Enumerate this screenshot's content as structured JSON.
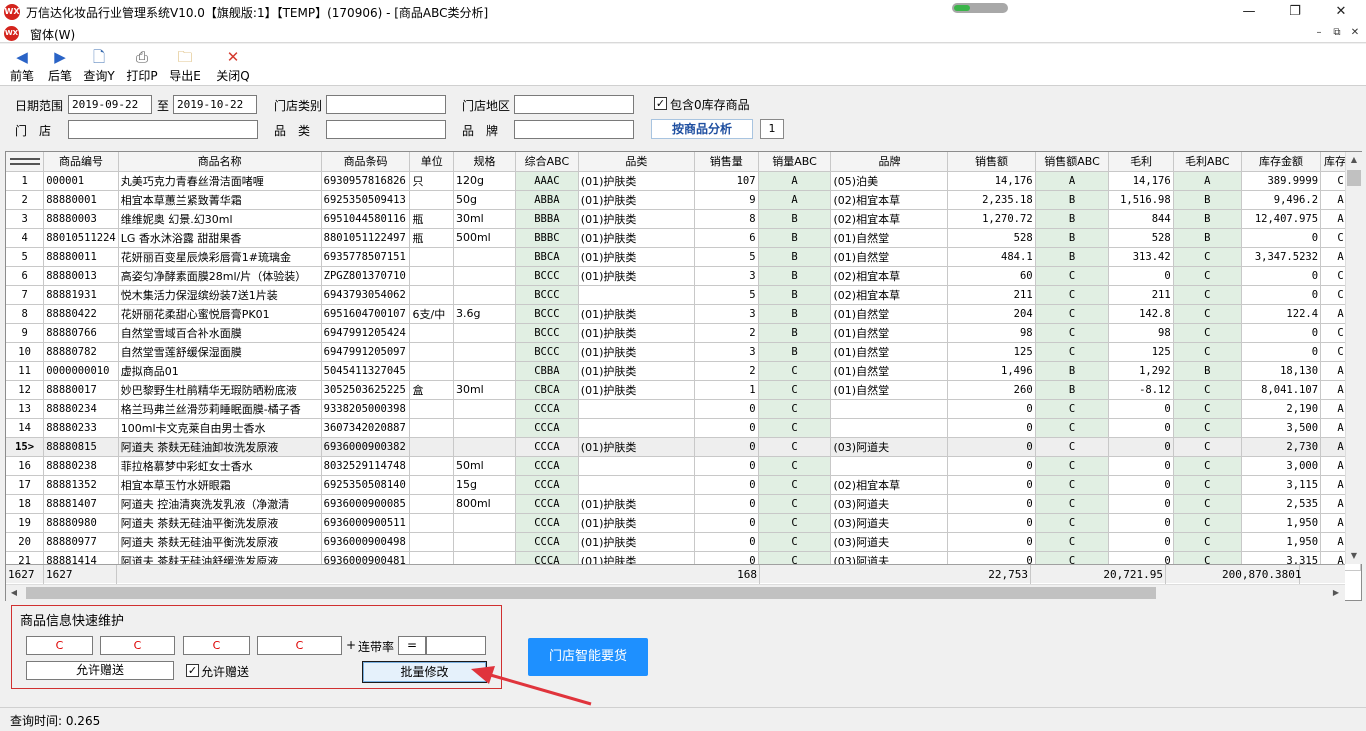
{
  "window": {
    "title": "万信达化妆品行业管理系统V10.0【旗舰版:1】【TEMP】(170906) - [商品ABC类分析]",
    "minimize_icon": "minimize-icon",
    "maximize_icon": "restore-icon",
    "close_icon": "close-icon"
  },
  "menu": {
    "window_label": "窗体(W)"
  },
  "toolbar": {
    "prev": "前笔",
    "next": "后笔",
    "query": "查询Y",
    "print": "打印P",
    "export": "导出E",
    "close": "关闭Q"
  },
  "filter": {
    "date_label": "日期范围",
    "date_from": "2019-09-22",
    "date_to_label": "至",
    "date_to": "2019-10-22",
    "store_type_label": "门店类别",
    "store_type": "",
    "store_area_label": "门店地区",
    "store_area": "",
    "include_zero_label": "包含0库存商品",
    "include_zero_checked": "✓",
    "store_label": "门　店",
    "store": "",
    "category_label": "品　类",
    "category": "",
    "brand_label": "品　牌",
    "brand": "",
    "analysis_mode": "按商品分析",
    "analysis_num": "1"
  },
  "grid": {
    "columns": [
      "商品编号",
      "商品名称",
      "商品条码",
      "单位",
      "规格",
      "综合ABC",
      "品类",
      "销售量",
      "销量ABC",
      "品牌",
      "销售额",
      "销售额ABC",
      "毛利",
      "毛利ABC",
      "库存金额",
      "库存金"
    ],
    "rows": [
      {
        "no": "1",
        "code": "000001",
        "name": "丸美巧克力青春丝滑洁面啫喱",
        "barcode": "6930957816826",
        "unit": "只",
        "spec": "120g",
        "abc": "AAAC",
        "ptype": "(01)护肤类",
        "qty": "107",
        "qabc": "A",
        "brand": "(05)泊美",
        "amt": "14,176",
        "aabc": "A",
        "profit": "14,176",
        "pabc": "A",
        "stock": "389.9999",
        "sabc": "C"
      },
      {
        "no": "2",
        "code": "88880001",
        "name": "相宜本草蕙兰紧致菁华霜",
        "barcode": "6925350509413",
        "unit": "",
        "spec": "50g",
        "abc": "ABBA",
        "ptype": "(01)护肤类",
        "qty": "9",
        "qabc": "A",
        "brand": "(02)相宜本草",
        "amt": "2,235.18",
        "aabc": "B",
        "profit": "1,516.98",
        "pabc": "B",
        "stock": "9,496.2",
        "sabc": "A"
      },
      {
        "no": "3",
        "code": "88880003",
        "name": "维维妮奥 幻景.幻30ml",
        "barcode": "6951044580116",
        "unit": "瓶",
        "spec": "30ml",
        "abc": "BBBA",
        "ptype": "(01)护肤类",
        "qty": "8",
        "qabc": "B",
        "brand": "(02)相宜本草",
        "amt": "1,270.72",
        "aabc": "B",
        "profit": "844",
        "pabc": "B",
        "stock": "12,407.975",
        "sabc": "A"
      },
      {
        "no": "4",
        "code": "88010511224",
        "name": "LG 香水沐浴露 甜甜果香",
        "barcode": "8801051122497",
        "unit": "瓶",
        "spec": "500ml",
        "abc": "BBBC",
        "ptype": "(01)护肤类",
        "qty": "6",
        "qabc": "B",
        "brand": "(01)自然堂",
        "amt": "528",
        "aabc": "B",
        "profit": "528",
        "pabc": "B",
        "stock": "0",
        "sabc": "C"
      },
      {
        "no": "5",
        "code": "88880011",
        "name": "花妍丽百变星辰焕彩唇膏1#琉璃金",
        "barcode": "6935778507151",
        "unit": "",
        "spec": "",
        "abc": "BBCA",
        "ptype": "(01)护肤类",
        "qty": "5",
        "qabc": "B",
        "brand": "(01)自然堂",
        "amt": "484.1",
        "aabc": "B",
        "profit": "313.42",
        "pabc": "C",
        "stock": "3,347.5232",
        "sabc": "A"
      },
      {
        "no": "6",
        "code": "88880013",
        "name": "高姿匀净酵素面膜28ml/片（体验装）",
        "barcode": "ZPGZ801370710",
        "unit": "",
        "spec": "",
        "abc": "BCCC",
        "ptype": "(01)护肤类",
        "qty": "3",
        "qabc": "B",
        "brand": "(02)相宜本草",
        "amt": "60",
        "aabc": "C",
        "profit": "0",
        "pabc": "C",
        "stock": "0",
        "sabc": "C"
      },
      {
        "no": "7",
        "code": "88881931",
        "name": "悦木集活力保湿缤纷装7送1片装",
        "barcode": "6943793054062",
        "unit": "",
        "spec": "",
        "abc": "BCCC",
        "ptype": "",
        "qty": "5",
        "qabc": "B",
        "brand": "(02)相宜本草",
        "amt": "211",
        "aabc": "C",
        "profit": "211",
        "pabc": "C",
        "stock": "0",
        "sabc": "C"
      },
      {
        "no": "8",
        "code": "88880422",
        "name": "花妍丽花柔甜心蜜悦唇膏PK01",
        "barcode": "6951604700107",
        "unit": "6支/中",
        "spec": "3.6g",
        "abc": "BCCC",
        "ptype": "(01)护肤类",
        "qty": "3",
        "qabc": "B",
        "brand": "(01)自然堂",
        "amt": "204",
        "aabc": "C",
        "profit": "142.8",
        "pabc": "C",
        "stock": "122.4",
        "sabc": "A"
      },
      {
        "no": "9",
        "code": "88880766",
        "name": "自然堂雪域百合补水面膜",
        "barcode": "6947991205424",
        "unit": "",
        "spec": "",
        "abc": "BCCC",
        "ptype": "(01)护肤类",
        "qty": "2",
        "qabc": "B",
        "brand": "(01)自然堂",
        "amt": "98",
        "aabc": "C",
        "profit": "98",
        "pabc": "C",
        "stock": "0",
        "sabc": "C"
      },
      {
        "no": "10",
        "code": "88880782",
        "name": "自然堂雪莲舒缓保湿面膜",
        "barcode": "6947991205097",
        "unit": "",
        "spec": "",
        "abc": "BCCC",
        "ptype": "(01)护肤类",
        "qty": "3",
        "qabc": "B",
        "brand": "(01)自然堂",
        "amt": "125",
        "aabc": "C",
        "profit": "125",
        "pabc": "C",
        "stock": "0",
        "sabc": "C"
      },
      {
        "no": "11",
        "code": "0000000010",
        "name": "虚拟商品01",
        "barcode": "5045411327045",
        "unit": "",
        "spec": "",
        "abc": "CBBA",
        "ptype": "(01)护肤类",
        "qty": "2",
        "qabc": "C",
        "brand": "(01)自然堂",
        "amt": "1,496",
        "aabc": "B",
        "profit": "1,292",
        "pabc": "B",
        "stock": "18,130",
        "sabc": "A"
      },
      {
        "no": "12",
        "code": "88880017",
        "name": "妙巴黎野生杜鹃精华无瑕防晒粉底液",
        "barcode": "3052503625225",
        "unit": "盒",
        "spec": "30ml",
        "abc": "CBCA",
        "ptype": "(01)护肤类",
        "qty": "1",
        "qabc": "C",
        "brand": "(01)自然堂",
        "amt": "260",
        "aabc": "B",
        "profit": "-8.12",
        "pabc": "C",
        "stock": "8,041.107",
        "sabc": "A"
      },
      {
        "no": "13",
        "code": "88880234",
        "name": "格兰玛弗兰丝滑莎莉睡眠面膜-橘子香",
        "barcode": "9338205000398",
        "unit": "",
        "spec": "",
        "abc": "CCCA",
        "ptype": "",
        "qty": "0",
        "qabc": "C",
        "brand": "",
        "amt": "0",
        "aabc": "C",
        "profit": "0",
        "pabc": "C",
        "stock": "2,190",
        "sabc": "A"
      },
      {
        "no": "14",
        "code": "88880233",
        "name": "100ml卡文克莱自由男士香水",
        "barcode": "3607342020887",
        "unit": "",
        "spec": "",
        "abc": "CCCA",
        "ptype": "",
        "qty": "0",
        "qabc": "C",
        "brand": "",
        "amt": "0",
        "aabc": "C",
        "profit": "0",
        "pabc": "C",
        "stock": "3,500",
        "sabc": "A"
      },
      {
        "no": "15>",
        "code": "88880815",
        "name": "阿道夫 茶麸无硅油卸妆洗发原液",
        "barcode": "6936000900382",
        "unit": "",
        "spec": "",
        "abc": "CCCA",
        "ptype": "(01)护肤类",
        "qty": "0",
        "qabc": "C",
        "brand": "(03)阿道夫",
        "amt": "0",
        "aabc": "C",
        "profit": "0",
        "pabc": "C",
        "stock": "2,730",
        "sabc": "A",
        "sel": true
      },
      {
        "no": "16",
        "code": "88880238",
        "name": "菲拉格慕梦中彩虹女士香水",
        "barcode": "8032529114748",
        "unit": "",
        "spec": "50ml",
        "abc": "CCCA",
        "ptype": "",
        "qty": "0",
        "qabc": "C",
        "brand": "",
        "amt": "0",
        "aabc": "C",
        "profit": "0",
        "pabc": "C",
        "stock": "3,000",
        "sabc": "A"
      },
      {
        "no": "17",
        "code": "88881352",
        "name": "相宜本草玉竹水妍眼霜",
        "barcode": "6925350508140",
        "unit": "",
        "spec": "15g",
        "abc": "CCCA",
        "ptype": "",
        "qty": "0",
        "qabc": "C",
        "brand": "(02)相宜本草",
        "amt": "0",
        "aabc": "C",
        "profit": "0",
        "pabc": "C",
        "stock": "3,115",
        "sabc": "A"
      },
      {
        "no": "18",
        "code": "88881407",
        "name": "阿道夫 控油清爽洗发乳液（净澈清",
        "barcode": "6936000900085",
        "unit": "",
        "spec": "800ml",
        "abc": "CCCA",
        "ptype": "(01)护肤类",
        "qty": "0",
        "qabc": "C",
        "brand": "(03)阿道夫",
        "amt": "0",
        "aabc": "C",
        "profit": "0",
        "pabc": "C",
        "stock": "2,535",
        "sabc": "A"
      },
      {
        "no": "19",
        "code": "88880980",
        "name": "阿道夫 茶麸无硅油平衡洗发原液",
        "barcode": "6936000900511",
        "unit": "",
        "spec": "",
        "abc": "CCCA",
        "ptype": "(01)护肤类",
        "qty": "0",
        "qabc": "C",
        "brand": "(03)阿道夫",
        "amt": "0",
        "aabc": "C",
        "profit": "0",
        "pabc": "C",
        "stock": "1,950",
        "sabc": "A"
      },
      {
        "no": "20",
        "code": "88880977",
        "name": "阿道夫 茶麸无硅油平衡洗发原液",
        "barcode": "6936000900498",
        "unit": "",
        "spec": "",
        "abc": "CCCA",
        "ptype": "(01)护肤类",
        "qty": "0",
        "qabc": "C",
        "brand": "(03)阿道夫",
        "amt": "0",
        "aabc": "C",
        "profit": "0",
        "pabc": "C",
        "stock": "1,950",
        "sabc": "A"
      },
      {
        "no": "21",
        "code": "88881414",
        "name": "阿道夫 茶麸无硅油舒缓洗发原液",
        "barcode": "6936000900481",
        "unit": "",
        "spec": "",
        "abc": "CCCA",
        "ptype": "(01)护肤类",
        "qty": "0",
        "qabc": "C",
        "brand": "(03)阿道夫",
        "amt": "0",
        "aabc": "C",
        "profit": "0",
        "pabc": "C",
        "stock": "3,315",
        "sabc": "A"
      }
    ],
    "footer": {
      "row_count": "1627",
      "code_count": "1627",
      "qty_total": "168",
      "amt_total": "22,753",
      "profit_total": "20,721.95",
      "stock_total": "200,870.3801"
    }
  },
  "quick_edit": {
    "title": "商品信息快速维护",
    "c1": "C",
    "c2": "C",
    "c3": "C",
    "c4": "C",
    "plus": "+",
    "joint_rate_label": "连带率",
    "eq": "=",
    "joint_rate_value": "",
    "allow_gift_button": "允许赠送",
    "allow_gift_check_label": "允许赠送",
    "allow_gift_checked": "✓",
    "batch_edit": "批量修改"
  },
  "smart_order_button": "门店智能要货",
  "status": {
    "query_time": "查询时间: 0.265"
  },
  "colors": {
    "accent": "#1e90ff",
    "abc_bg": "#e1efe3",
    "panel_border": "#d03030",
    "arrow": "#e0343c"
  }
}
